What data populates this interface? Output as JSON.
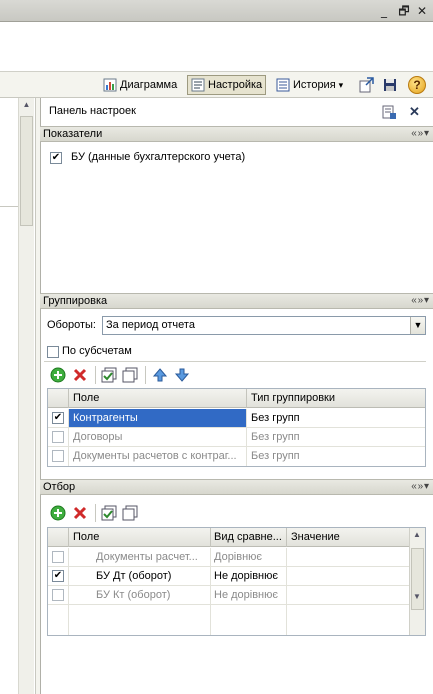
{
  "window": {
    "minimize": "_",
    "restore": "🗗",
    "close": "✕"
  },
  "toolbar": {
    "diagram_label": "Диаграмма",
    "settings_label": "Настройка",
    "history_label": "История",
    "history_arrow": "▾",
    "help_label": "?"
  },
  "panel": {
    "title": "Панель настроек",
    "close": "✕"
  },
  "indicators": {
    "header": "Показатели",
    "item_label": "БУ (данные бухгалтерского учета)",
    "item_checked": true
  },
  "grouping": {
    "header": "Группировка",
    "turnovers_label": "Обороты:",
    "turnovers_value": "За период отчета",
    "subaccounts_label": "По субсчетам",
    "columns": [
      "Поле",
      "Тип группировки"
    ],
    "rows": [
      {
        "field": "Контрагенты",
        "type": "Без групп",
        "checked": true,
        "selected": true
      },
      {
        "field": "Договоры",
        "type": "Без групп",
        "checked": false,
        "selected": false
      },
      {
        "field": "Документы расчетов с контраг...",
        "type": "Без групп",
        "checked": false,
        "selected": false
      }
    ]
  },
  "filter": {
    "header": "Отбор",
    "columns": [
      "Поле",
      "Вид сравне...",
      "Значение"
    ],
    "rows": [
      {
        "field": "Документы расчет...",
        "comparison": "Дорівнює",
        "value": "",
        "checked": false
      },
      {
        "field": "БУ Дт (оборот)",
        "comparison": "Не дорівнює",
        "value": "",
        "checked": true
      },
      {
        "field": "БУ Кт (оборот)",
        "comparison": "Не дорівнює",
        "value": "",
        "checked": false
      }
    ]
  },
  "section_controls": "« » ▾",
  "colors": {
    "accent": "#316ac5",
    "green": "#2e9a2e",
    "red": "#d02a2a"
  }
}
